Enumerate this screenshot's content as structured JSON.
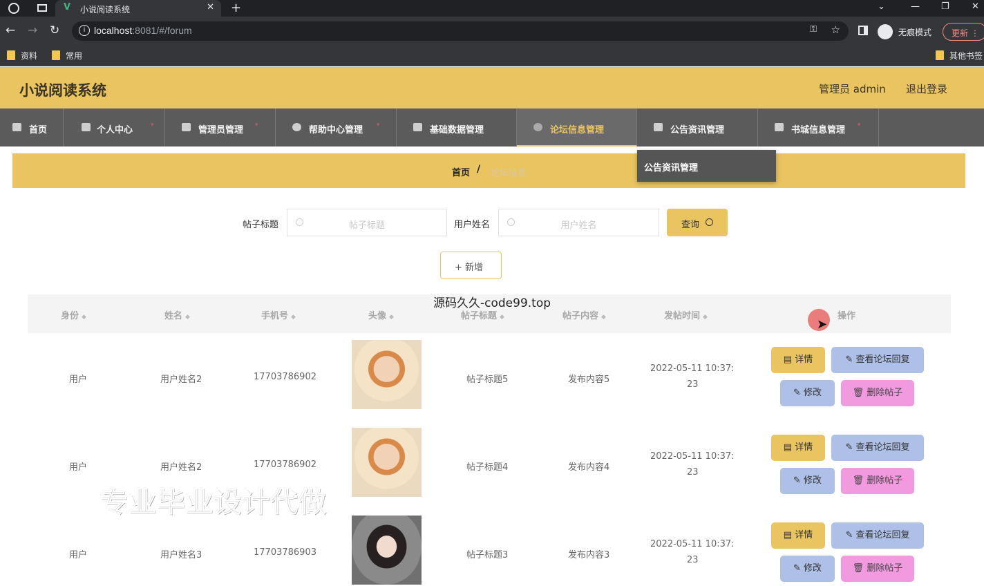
{
  "browser": {
    "tab_title": "小说阅读系统",
    "tab_vue_logo": "V",
    "url_host": "localhost",
    "url_rest": ":8081/#/forum",
    "incognito_label": "无痕模式",
    "update_label": "更新",
    "bookmarks": [
      "资料",
      "常用"
    ],
    "other_bookmarks": "其他书签"
  },
  "header": {
    "title": "小说阅读系统",
    "user": "管理员 admin",
    "logout": "退出登录"
  },
  "nav": {
    "items": [
      {
        "label": "首页"
      },
      {
        "label": "个人中心"
      },
      {
        "label": "管理员管理"
      },
      {
        "label": "帮助中心管理"
      },
      {
        "label": "基础数据管理"
      },
      {
        "label": "论坛信息管理"
      },
      {
        "label": "公告资讯管理"
      },
      {
        "label": "书城信息管理"
      }
    ],
    "dropdown_item": "公告资讯管理"
  },
  "breadcrumb": {
    "home": "首页",
    "separator": "/",
    "current": "论坛信息"
  },
  "search": {
    "title_label": "帖子标题",
    "title_placeholder": "帖子标题",
    "user_label": "用户姓名",
    "user_placeholder": "用户姓名",
    "query_label": "查询",
    "add_label": "+ 新增"
  },
  "watermarks": {
    "center": "源码久久-code99.top",
    "big": "专业毕业设计代做"
  },
  "table": {
    "headers": [
      "身份",
      "姓名",
      "手机号",
      "头像",
      "帖子标题",
      "帖子内容",
      "发帖时间",
      "操作"
    ],
    "rows": [
      {
        "identity": "用户",
        "name": "用户姓名2",
        "phone": "17703786902",
        "title": "帖子标题5",
        "content": "发布内容5",
        "time1": "2022-05-11 10:37:",
        "time2": "23"
      },
      {
        "identity": "用户",
        "name": "用户姓名2",
        "phone": "17703786902",
        "title": "帖子标题4",
        "content": "发布内容4",
        "time1": "2022-05-11 10:37:",
        "time2": "23"
      },
      {
        "identity": "用户",
        "name": "用户姓名3",
        "phone": "17703786903",
        "title": "帖子标题3",
        "content": "发布内容3",
        "time1": "2022-05-11 10:37:",
        "time2": "23"
      }
    ],
    "actions": {
      "detail": "详情",
      "view_reply": "查看论坛回复",
      "edit": "修改",
      "delete": "删除帖子"
    }
  },
  "colors": {
    "accent": "#e9c460",
    "nav_bg": "#5b5b5b",
    "btn_blue": "#aebfe8",
    "btn_pink": "#f29ae0"
  }
}
